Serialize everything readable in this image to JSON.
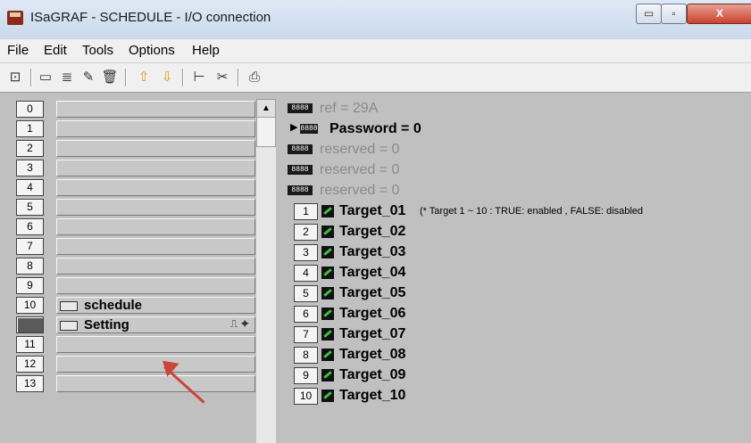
{
  "window": {
    "title": "ISaGRAF - SCHEDULE - I/O connection",
    "close_glyph": "X",
    "min_glyph": "▭",
    "max_glyph": "▫"
  },
  "menu": [
    "File",
    "Edit",
    "Tools",
    "Options",
    "Help"
  ],
  "toolbar": {
    "buttons": [
      {
        "icon": "board-icon",
        "glyph": "⊡"
      },
      {
        "icon": "connect-icon",
        "glyph": "▭"
      },
      {
        "icon": "config-icon",
        "glyph": "≣"
      },
      {
        "icon": "parameter-icon",
        "glyph": "✎"
      },
      {
        "icon": "delete-icon",
        "glyph": "🗑"
      },
      {
        "icon": "move-up-icon",
        "glyph": "⇧"
      },
      {
        "icon": "move-down-icon",
        "glyph": "⇩"
      },
      {
        "icon": "structure-icon",
        "glyph": "⊢"
      },
      {
        "icon": "cut-icon",
        "glyph": "✂"
      },
      {
        "icon": "print-icon",
        "glyph": "⎙"
      }
    ]
  },
  "slots": [
    {
      "num": "0",
      "label": ""
    },
    {
      "num": "1",
      "label": ""
    },
    {
      "num": "2",
      "label": ""
    },
    {
      "num": "3",
      "label": ""
    },
    {
      "num": "4",
      "label": ""
    },
    {
      "num": "5",
      "label": ""
    },
    {
      "num": "6",
      "label": ""
    },
    {
      "num": "7",
      "label": ""
    },
    {
      "num": "8",
      "label": ""
    },
    {
      "num": "9",
      "label": ""
    },
    {
      "num": "10",
      "label": "schedule",
      "icon": "board-icon"
    },
    {
      "num": "",
      "label": "Setting",
      "icon": "module-icon",
      "extra": "⎍ ✦",
      "selected": true
    },
    {
      "num": "11",
      "label": ""
    },
    {
      "num": "12",
      "label": ""
    },
    {
      "num": "13",
      "label": ""
    }
  ],
  "channels": [
    {
      "kind": "hex",
      "text": "ref = 29A",
      "grey": true
    },
    {
      "kind": "hex-selected",
      "text": "Password = 0",
      "grey": false
    },
    {
      "kind": "hex",
      "text": "reserved = 0",
      "grey": true
    },
    {
      "kind": "hex",
      "text": "reserved = 0",
      "grey": true
    },
    {
      "kind": "hex",
      "text": "reserved = 0",
      "grey": true
    },
    {
      "kind": "bool",
      "num": "1",
      "text": "Target_01",
      "comment": "(* Target 1 ~ 10 : TRUE: enabled , FALSE: disabled"
    },
    {
      "kind": "bool",
      "num": "2",
      "text": "Target_02"
    },
    {
      "kind": "bool",
      "num": "3",
      "text": "Target_03"
    },
    {
      "kind": "bool",
      "num": "4",
      "text": "Target_04"
    },
    {
      "kind": "bool",
      "num": "5",
      "text": "Target_05"
    },
    {
      "kind": "bool",
      "num": "6",
      "text": "Target_06"
    },
    {
      "kind": "bool",
      "num": "7",
      "text": "Target_07"
    },
    {
      "kind": "bool",
      "num": "8",
      "text": "Target_08"
    },
    {
      "kind": "bool",
      "num": "9",
      "text": "Target_09"
    },
    {
      "kind": "bool",
      "num": "10",
      "text": "Target_10"
    }
  ],
  "hex_glyph": "8888",
  "scroll_up_glyph": "▲"
}
